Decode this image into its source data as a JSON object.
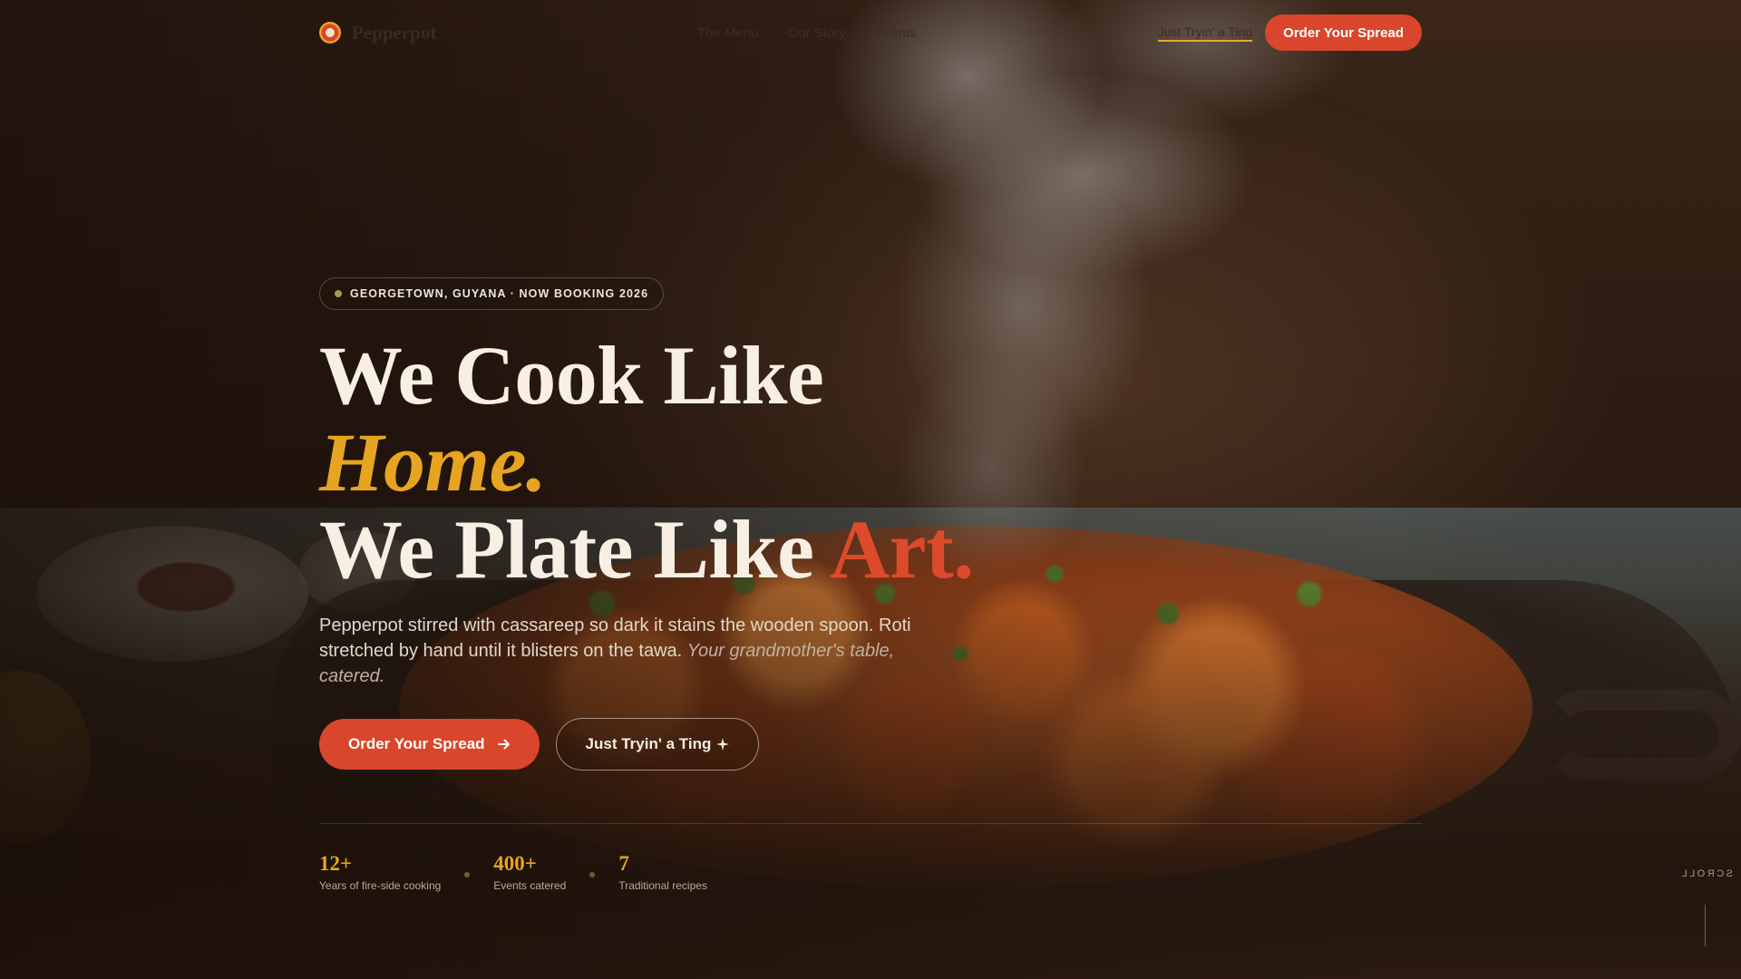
{
  "brand": {
    "name": "Pepperpot",
    "logo_icon": "pepperpot-logo-icon"
  },
  "nav": {
    "items": [
      {
        "label": "The Menu"
      },
      {
        "label": "Our Story"
      },
      {
        "label": "Events"
      }
    ]
  },
  "header": {
    "link_label": "Just Tryin' a Ting",
    "cta_label": "Order Your Spread"
  },
  "hero": {
    "badge": "GEORGETOWN, GUYANA · NOW BOOKING 2026",
    "headline_line1": "We Cook Like",
    "headline_home": "Home.",
    "headline_line3_prefix": "We Plate Like ",
    "headline_art": "Art.",
    "lede_main": "Pepperpot stirred with cassareep so dark it stains the wooden spoon. Roti stretched by hand until it blisters on the tawa.",
    "lede_italic": "Your grandmother's table, catered.",
    "cta_primary": "Order Your Spread",
    "cta_primary_icon": "arrow-right-icon",
    "cta_secondary": "Just Tryin' a Ting",
    "cta_secondary_icon": "sparkle-icon"
  },
  "stats": [
    {
      "value": "12+",
      "label": "Years of fire-side cooking"
    },
    {
      "value": "400+",
      "label": "Events catered"
    },
    {
      "value": "7",
      "label": "Traditional recipes"
    }
  ],
  "scroll_label": "SCROLL",
  "colors": {
    "accent_red": "#d9462b",
    "accent_gold": "#e6a421",
    "cream": "#f7efe3",
    "dark_bg": "#1c110b"
  }
}
